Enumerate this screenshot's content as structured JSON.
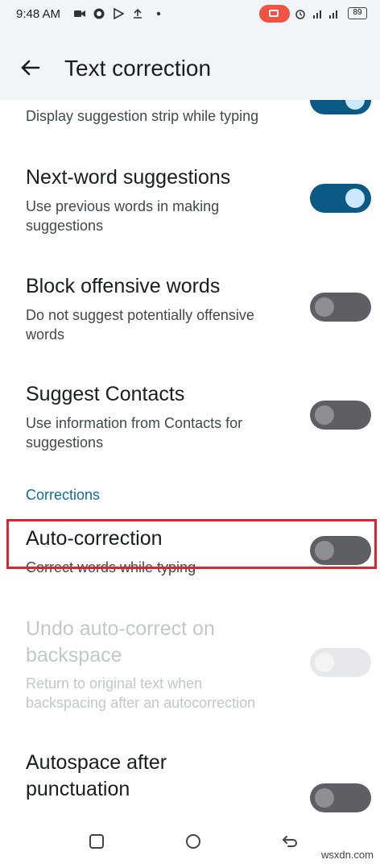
{
  "status_bar": {
    "time": "9:48 AM",
    "battery": "89"
  },
  "app_bar": {
    "title": "Text correction",
    "back_icon": "arrow-back-icon"
  },
  "settings": [
    {
      "id": "suggestion-strip",
      "title": "",
      "summary": "Display suggestion strip while typing",
      "state": "on"
    },
    {
      "id": "next-word",
      "title": "Next-word suggestions",
      "summary": "Use previous words in making suggestions",
      "state": "on"
    },
    {
      "id": "block-offensive",
      "title": "Block offensive words",
      "summary": "Do not suggest potentially offensive words",
      "state": "off"
    },
    {
      "id": "suggest-contacts",
      "title": "Suggest Contacts",
      "summary": "Use information from Contacts for suggestions",
      "state": "off"
    },
    {
      "id": "auto-correction",
      "title": "Auto-correction",
      "summary": "Correct words while typing",
      "state": "off"
    },
    {
      "id": "undo-autocorrect",
      "title": "Undo auto-correct on backspace",
      "summary": "Return to original text when backspacing after an autocorrection",
      "state": "disabled"
    },
    {
      "id": "autospace",
      "title": "Autospace after punctuation",
      "summary": "",
      "state": "off"
    }
  ],
  "section_corrections": "Corrections",
  "colors": {
    "accent": "#0b5a86",
    "highlight_box": "#e0242f",
    "section_header": "#136b9a"
  },
  "watermark": "wsxdn.com"
}
